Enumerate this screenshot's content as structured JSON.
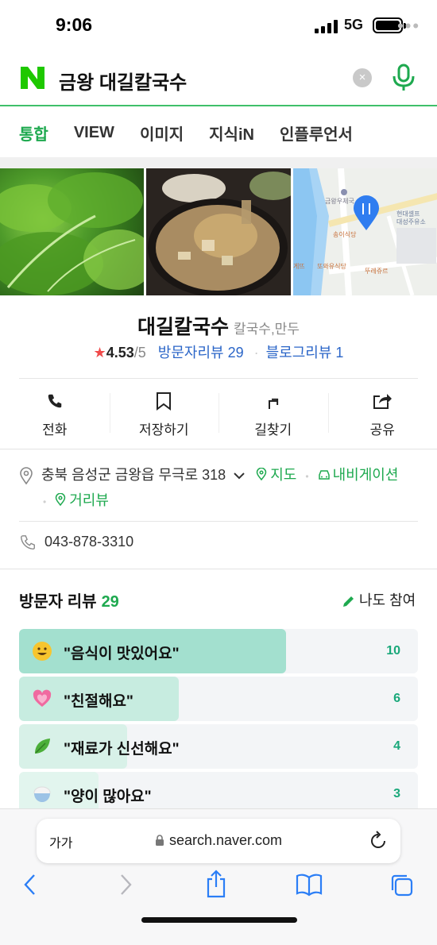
{
  "status_bar": {
    "time": "9:06",
    "network": "5G"
  },
  "search": {
    "query": "금왕 대길칼국수",
    "clear_label": "×"
  },
  "tabs": [
    {
      "label": "통합",
      "active": true
    },
    {
      "label": "VIEW",
      "active": false
    },
    {
      "label": "이미지",
      "active": false
    },
    {
      "label": "지식iN",
      "active": false
    },
    {
      "label": "인플루언서",
      "active": false
    }
  ],
  "tabs_more": "•••",
  "map_labels": {
    "post_office": "금왕우체국",
    "store1": "현대셀프",
    "store2": "대성주유소",
    "shop1": "송이식당",
    "shop2": "또와유식당",
    "shop3": "뚜레쥬르",
    "shop4": "게뜨"
  },
  "place": {
    "name": "대길칼국수",
    "category": "칼국수,만두",
    "star": "★",
    "rating": "4.53",
    "rating_max": "/5",
    "visitor_reviews": "방문자리뷰 29",
    "blog_reviews": "블로그리뷰 1",
    "dot": "·"
  },
  "actions": [
    {
      "label": "전화",
      "icon": "phone-icon"
    },
    {
      "label": "저장하기",
      "icon": "bookmark-icon"
    },
    {
      "label": "길찾기",
      "icon": "directions-icon"
    },
    {
      "label": "공유",
      "icon": "share-icon"
    }
  ],
  "info": {
    "address": "충북 음성군 금왕읍 무극로 318",
    "map_link": "지도",
    "navigation_link": "내비게이션",
    "street_view_link": "거리뷰",
    "phone": "043-878-3310"
  },
  "reviews": {
    "title": "방문자 리뷰",
    "count": "29",
    "join_label": "나도 참여",
    "items": [
      {
        "text": "\"음식이 맛있어요\"",
        "count": "10",
        "fraction": 0.67,
        "emoji": "smile-emoji-icon"
      },
      {
        "text": "\"친절해요\"",
        "count": "6",
        "fraction": 0.4,
        "emoji": "heart-emoji-icon"
      },
      {
        "text": "\"재료가 신선해요\"",
        "count": "4",
        "fraction": 0.27,
        "emoji": "leaf-emoji-icon"
      },
      {
        "text": "\"양이 많아요\"",
        "count": "3",
        "fraction": 0.2,
        "emoji": "rice-bowl-emoji-icon"
      }
    ]
  },
  "browser": {
    "text_size_label": "가가",
    "url": "search.naver.com"
  },
  "colors": {
    "naver_green": "#1ea94f",
    "link_blue": "#2b66c8",
    "review_bar": "#a8e3d1",
    "star_red": "#f04b4b"
  }
}
